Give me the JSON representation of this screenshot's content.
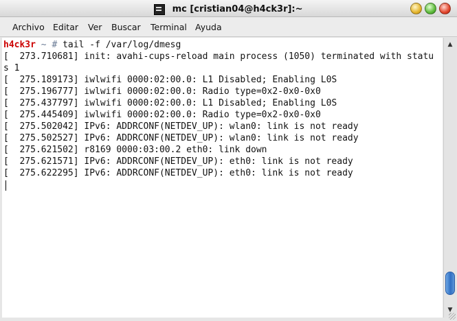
{
  "window": {
    "title": "mc [cristian04@h4ck3r]:~"
  },
  "menu": {
    "items": [
      "Archivo",
      "Editar",
      "Ver",
      "Buscar",
      "Terminal",
      "Ayuda"
    ]
  },
  "terminal": {
    "prompt_user": "h4ck3r",
    "prompt_rest": " ~ # ",
    "command": "tail -f /var/log/dmesg",
    "lines": [
      "[  273.710681] init: avahi-cups-reload main process (1050) terminated with statu",
      "s 1",
      "[  275.189173] iwlwifi 0000:02:00.0: L1 Disabled; Enabling L0S",
      "[  275.196777] iwlwifi 0000:02:00.0: Radio type=0x2-0x0-0x0",
      "[  275.437797] iwlwifi 0000:02:00.0: L1 Disabled; Enabling L0S",
      "[  275.445409] iwlwifi 0000:02:00.0: Radio type=0x2-0x0-0x0",
      "[  275.502042] IPv6: ADDRCONF(NETDEV_UP): wlan0: link is not ready",
      "[  275.502527] IPv6: ADDRCONF(NETDEV_UP): wlan0: link is not ready",
      "[  275.621502] r8169 0000:03:00.2 eth0: link down",
      "[  275.621571] IPv6: ADDRCONF(NETDEV_UP): eth0: link is not ready",
      "[  275.622295] IPv6: ADDRCONF(NETDEV_UP): eth0: link is not ready"
    ]
  },
  "icons": {
    "app": "terminal-icon",
    "minimize": "minimize-icon",
    "maximize": "maximize-icon",
    "close": "close-icon",
    "scroll_up": "arrow-up-icon",
    "scroll_down": "arrow-down-icon"
  },
  "colors": {
    "prompt_user": "#cc0000",
    "prompt_rest": "#6a7b95",
    "scroll_thumb": "#2f6fc2",
    "close_button": "#e2462c",
    "minimize_button": "#e4b42c",
    "maximize_button": "#5cba3a"
  },
  "scroll": {
    "position_fraction": 0.96
  }
}
